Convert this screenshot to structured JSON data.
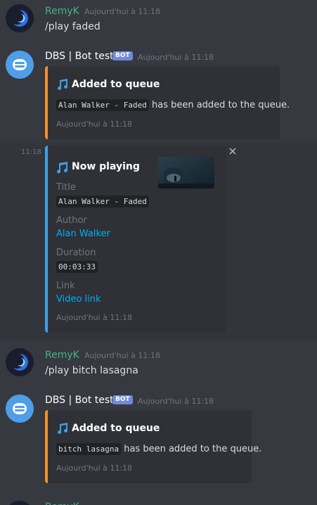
{
  "users": {
    "remy": "RemyK",
    "bot": "DBS | Bot test",
    "bot_badge": "BOT"
  },
  "timestamp": "Aujourd'hui à 11:18",
  "msg1": {
    "content": "/play faded"
  },
  "embed1": {
    "title": "Added to queue",
    "code": "Alan Walker - Faded",
    "desc": "has been added to the queue.",
    "footer": "Aujourd'hui à 11:18"
  },
  "now_playing": {
    "side_time": "11:18",
    "title": "Now playing",
    "fields": [
      {
        "name": "Title",
        "value": "Alan Walker - Faded"
      },
      {
        "name": "Author",
        "value": "Alan Walker"
      },
      {
        "name": "Duration",
        "value": "00:03:33"
      },
      {
        "name": "Link",
        "value": "Video link"
      }
    ],
    "footer": "Aujourd'hui à 11:18"
  },
  "msg2": {
    "content": "/play bitch lasagna"
  },
  "embed2": {
    "title": "Added to queue",
    "code": "bitch lasagna",
    "desc": "has been added to the queue.",
    "footer": "Aujourd'hui à 11:18"
  },
  "colors": {
    "accent_orange": "#f0922b",
    "accent_blue": "#3fa0e6",
    "link": "#00b0f4",
    "username": "#43b581"
  },
  "icons": {
    "music_multi": "music-notes-icon",
    "music_single": "music-note-icon",
    "close": "close-icon"
  }
}
